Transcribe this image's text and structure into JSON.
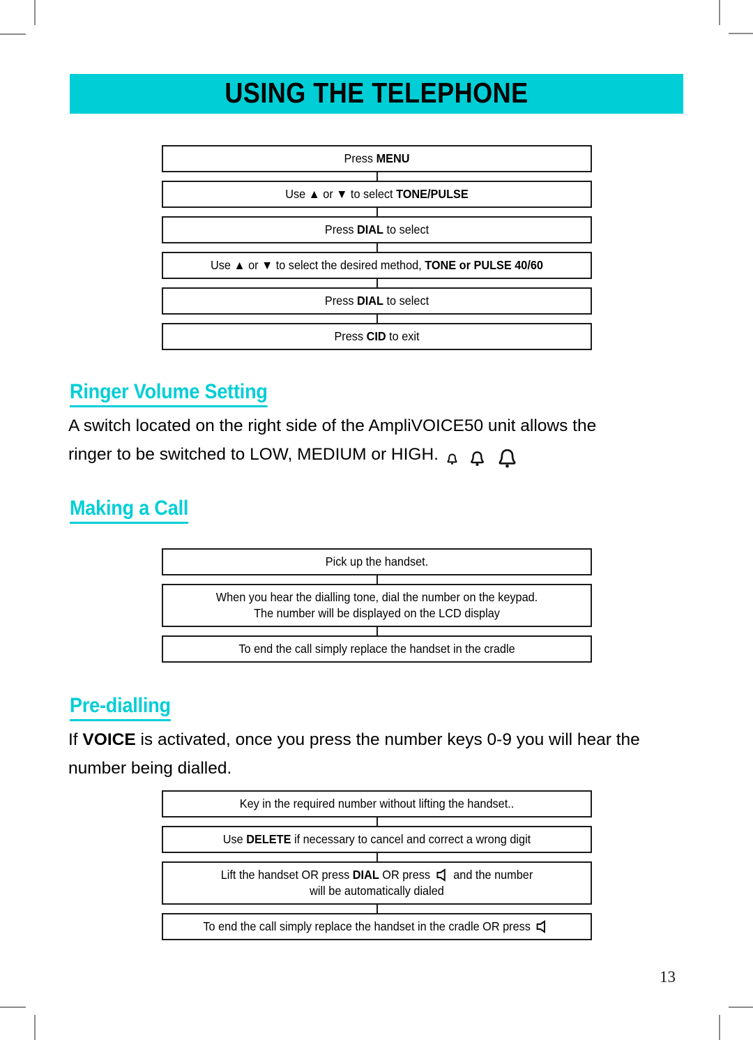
{
  "page": {
    "banner_title": "USING THE TELEPHONE",
    "page_number": "13",
    "accent_color": "#00ced6",
    "text_color": "#000000",
    "crop_mark_color": "#8a8a8a"
  },
  "tone_pulse_flow": {
    "name": "tone-pulse-flowchart",
    "steps": [
      {
        "lines": [
          {
            "parts": [
              {
                "t": "Press ",
                "b": false
              },
              {
                "t": "MENU",
                "b": true
              }
            ]
          }
        ]
      },
      {
        "lines": [
          {
            "parts": [
              {
                "t": "Use ▲ or ▼ to select ",
                "b": false
              },
              {
                "t": "TONE/PULSE",
                "b": true
              }
            ]
          }
        ]
      },
      {
        "lines": [
          {
            "parts": [
              {
                "t": "Press ",
                "b": false
              },
              {
                "t": "DIAL",
                "b": true
              },
              {
                "t": "  to select",
                "b": false
              }
            ]
          }
        ]
      },
      {
        "lines": [
          {
            "parts": [
              {
                "t": "Use ▲ or ▼ to select  the desired method, ",
                "b": false
              },
              {
                "t": "TONE or PULSE 40/60",
                "b": true
              }
            ]
          }
        ]
      },
      {
        "lines": [
          {
            "parts": [
              {
                "t": "Press ",
                "b": false
              },
              {
                "t": "DIAL",
                "b": true
              },
              {
                "t": "  to select",
                "b": false
              }
            ]
          }
        ]
      },
      {
        "lines": [
          {
            "parts": [
              {
                "t": "Press ",
                "b": false
              },
              {
                "t": "CID",
                "b": true
              },
              {
                "t": " to exit",
                "b": false
              }
            ]
          }
        ]
      }
    ]
  },
  "ringer_section": {
    "heading": "Ringer Volume Setting",
    "body_line_1": "A switch located on the right side of the AmpliVOICE50 unit allows the",
    "body_line_2": "ringer to be switched to LOW, MEDIUM or HIGH.",
    "icons": [
      "bell-small-icon",
      "bell-medium-icon",
      "bell-large-icon"
    ]
  },
  "making_a_call": {
    "heading": "Making a Call",
    "flow": {
      "name": "making-a-call-flowchart",
      "steps": [
        {
          "lines": [
            {
              "parts": [
                {
                  "t": "Pick up the handset.",
                  "b": false
                }
              ]
            }
          ]
        },
        {
          "lines": [
            {
              "parts": [
                {
                  "t": "When you hear the dialling tone, dial the number on the keypad.",
                  "b": false
                }
              ]
            },
            {
              "parts": [
                {
                  "t": "The number will be displayed on the LCD display",
                  "b": false
                }
              ]
            }
          ]
        },
        {
          "lines": [
            {
              "parts": [
                {
                  "t": "To end the call simply replace the handset in the cradle",
                  "b": false
                }
              ]
            }
          ]
        }
      ]
    }
  },
  "pre_dialling": {
    "heading": "Pre-dialling",
    "body_prefix": "If ",
    "body_bold": "VOICE",
    "body_line_1_rest": " is activated, once you press the number keys 0-9 you will hear the",
    "body_line_2": "number being dialled.",
    "flow": {
      "name": "pre-dialling-flowchart",
      "steps": [
        {
          "lines": [
            {
              "parts": [
                {
                  "t": "Key in the required number without lifting the handset..",
                  "b": false
                }
              ]
            }
          ]
        },
        {
          "lines": [
            {
              "parts": [
                {
                  "t": "Use ",
                  "b": false
                },
                {
                  "t": "DELETE",
                  "b": true
                },
                {
                  "t": " if necessary to cancel and correct a wrong digit",
                  "b": false
                }
              ]
            }
          ]
        },
        {
          "lines": [
            {
              "parts": [
                {
                  "t": "Lift the handset OR press ",
                  "b": false
                },
                {
                  "t": "DIAL",
                  "b": true
                },
                {
                  "t": "  OR press ",
                  "b": false
                },
                {
                  "icon": "speaker-icon"
                },
                {
                  "t": " and the number",
                  "b": false
                }
              ]
            },
            {
              "parts": [
                {
                  "t": "will be automatically dialed",
                  "b": false
                }
              ]
            }
          ]
        },
        {
          "lines": [
            {
              "parts": [
                {
                  "t": "To end the call simply replace the handset in the cradle OR press ",
                  "b": false
                },
                {
                  "icon": "speaker-icon"
                }
              ]
            }
          ]
        }
      ]
    }
  }
}
